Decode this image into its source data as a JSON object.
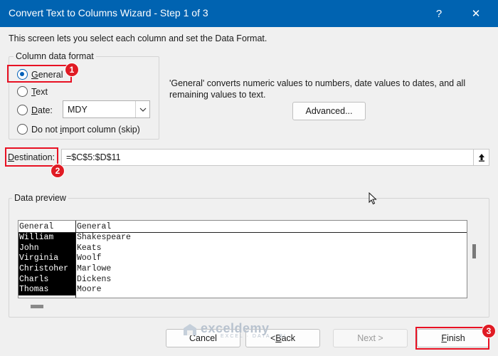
{
  "window": {
    "title": "Convert Text to Columns Wizard - Step 1 of 3",
    "help_label": "?",
    "close_label": "✕"
  },
  "intro_text": "This screen lets you select each column and set the Data Format.",
  "column_format": {
    "legend": "Column data format",
    "options": [
      {
        "pre": "",
        "key": "G",
        "post": "eneral",
        "selected": true
      },
      {
        "pre": "",
        "key": "T",
        "post": "ext",
        "selected": false
      },
      {
        "pre": "",
        "key": "D",
        "post": "ate:",
        "selected": false
      },
      {
        "pre": "Do not ",
        "key": "i",
        "post": "mport column (skip)",
        "selected": false
      }
    ],
    "date_format": "MDY"
  },
  "info_text": "'General' converts numeric values to numbers, date values to dates, and all remaining values to text.",
  "advanced_button": "Advanced...",
  "destination": {
    "label_key": "D",
    "label_rest": "estination:",
    "value": "=$C$5:$D$11"
  },
  "preview": {
    "legend": "Data preview",
    "columns": [
      {
        "header": "General",
        "values": [
          "William",
          "John",
          "Virginia",
          "Christoher",
          "Charls",
          "Thomas"
        ]
      },
      {
        "header": "General",
        "values": [
          "Shakespeare",
          "Keats",
          "Woolf",
          "Marlowe",
          "Dickens",
          "Moore"
        ]
      }
    ]
  },
  "footer": {
    "cancel": "Cancel",
    "back_pre": "< ",
    "back_key": "B",
    "back_post": "ack",
    "next": "Next >",
    "finish_key": "F",
    "finish_post": "inish"
  },
  "annotations": [
    "1",
    "2",
    "3"
  ],
  "watermark": {
    "name": "exceldemy",
    "tagline": "EXCEL · DATA · BI"
  },
  "colors": {
    "titlebar": "#0063b1",
    "accent": "#005fb8",
    "annotation": "#e81123"
  }
}
